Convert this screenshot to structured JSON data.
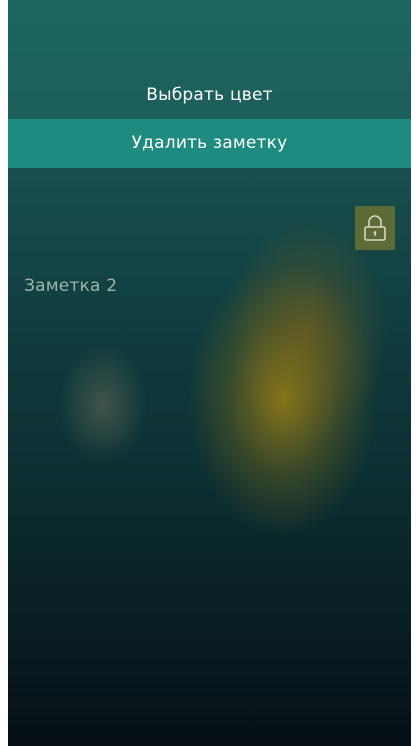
{
  "menu": {
    "pick_color_label": "Выбрать цвет",
    "delete_note_label": "Удалить заметку"
  },
  "note": {
    "title": "Заметка 2"
  },
  "lock": {
    "icon": "lock-open-icon"
  },
  "colors": {
    "menu_background": "#1d6660",
    "delete_highlight": "#1e8a80",
    "lock_button": "#5d6c37",
    "note_title_text": "#9eb3ad"
  }
}
